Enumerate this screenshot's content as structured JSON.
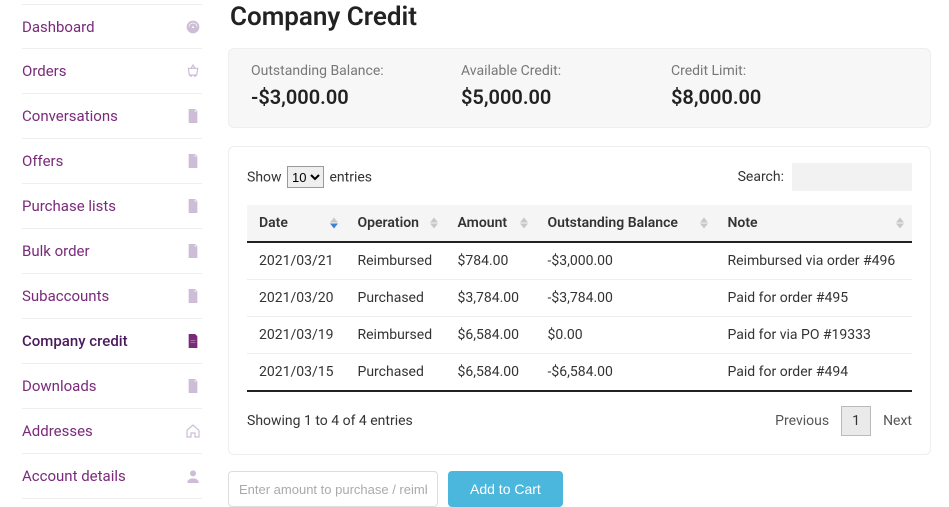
{
  "sidebar": {
    "items": [
      {
        "label": "Dashboard",
        "icon": "dashboard-icon"
      },
      {
        "label": "Orders",
        "icon": "basket-icon"
      },
      {
        "label": "Conversations",
        "icon": "document-icon"
      },
      {
        "label": "Offers",
        "icon": "document-icon"
      },
      {
        "label": "Purchase lists",
        "icon": "document-icon"
      },
      {
        "label": "Bulk order",
        "icon": "document-icon"
      },
      {
        "label": "Subaccounts",
        "icon": "document-icon"
      },
      {
        "label": "Company credit",
        "icon": "document-filled-icon",
        "active": true
      },
      {
        "label": "Downloads",
        "icon": "document-icon"
      },
      {
        "label": "Addresses",
        "icon": "home-icon"
      },
      {
        "label": "Account details",
        "icon": "user-icon"
      }
    ]
  },
  "page": {
    "title": "Company Credit"
  },
  "summary": {
    "outstanding_label": "Outstanding Balance:",
    "outstanding_value": "-$3,000.00",
    "available_label": "Available Credit:",
    "available_value": "$5,000.00",
    "limit_label": "Credit Limit:",
    "limit_value": "$8,000.00"
  },
  "table": {
    "show_prefix": "Show",
    "show_suffix": "entries",
    "entries_options": [
      "10"
    ],
    "entries_selected": "10",
    "search_label": "Search:",
    "search_value": "",
    "columns": [
      "Date",
      "Operation",
      "Amount",
      "Outstanding Balance",
      "Note"
    ],
    "sort_col": 0,
    "sort_dir": "asc",
    "rows": [
      {
        "date": "2021/03/21",
        "operation": "Reimbursed",
        "amount": "$784.00",
        "balance": "-$3,000.00",
        "note": "Reimbursed via order #496"
      },
      {
        "date": "2021/03/20",
        "operation": "Purchased",
        "amount": "$3,784.00",
        "balance": "-$3,784.00",
        "note": "Paid for order #495"
      },
      {
        "date": "2021/03/19",
        "operation": "Reimbursed",
        "amount": "$6,584.00",
        "balance": "$0.00",
        "note": "Paid for via PO #19333"
      },
      {
        "date": "2021/03/15",
        "operation": "Purchased",
        "amount": "$6,584.00",
        "balance": "-$6,584.00",
        "note": "Paid for order #494"
      }
    ],
    "info": "Showing 1 to 4 of 4 entries",
    "prev": "Previous",
    "next": "Next",
    "page": "1"
  },
  "purchase": {
    "placeholder": "Enter amount to purchase / reimburse...",
    "value": "",
    "button": "Add to Cart"
  }
}
